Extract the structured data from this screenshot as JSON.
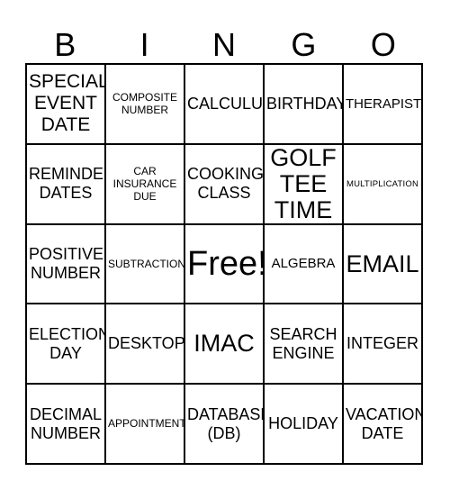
{
  "card": {
    "title": "BINGO",
    "header_letters": [
      "B",
      "I",
      "N",
      "G",
      "O"
    ],
    "grid_size": "5x5",
    "free_space_index": 12,
    "colors": {
      "background": "#ffffff",
      "text": "#000000",
      "border": "#000000"
    },
    "rows": [
      [
        {
          "text": "SPECIAL\nEVENT\nDATE",
          "size": "lg"
        },
        {
          "text": "COMPOSITE\nNUMBER",
          "size": "xs"
        },
        {
          "text": "CALCULUS",
          "size": "md"
        },
        {
          "text": "BIRTHDAY",
          "size": "md"
        },
        {
          "text": "THERAPIST",
          "size": "sm"
        }
      ],
      [
        {
          "text": "REMINDER\nDATES",
          "size": "md"
        },
        {
          "text": "CAR\nINSURANCE\nDUE",
          "size": "xs"
        },
        {
          "text": "COOKING\nCLASS",
          "size": "md"
        },
        {
          "text": "GOLF\nTEE\nTIME",
          "size": "xl"
        },
        {
          "text": "MULTIPLICATION",
          "size": "xxs"
        }
      ],
      [
        {
          "text": "POSITIVE\nNUMBER",
          "size": "md"
        },
        {
          "text": "SUBTRACTION",
          "size": "xs"
        },
        {
          "text": "Free!",
          "size": "xxl"
        },
        {
          "text": "ALGEBRA",
          "size": "sm"
        },
        {
          "text": "EMAIL",
          "size": "xl"
        }
      ],
      [
        {
          "text": "ELECTION\nDAY",
          "size": "md"
        },
        {
          "text": "DESKTOP",
          "size": "md"
        },
        {
          "text": "IMAC",
          "size": "xl"
        },
        {
          "text": "SEARCH\nENGINE",
          "size": "md"
        },
        {
          "text": "INTEGER",
          "size": "md"
        }
      ],
      [
        {
          "text": "DECIMAL\nNUMBER",
          "size": "md"
        },
        {
          "text": "APPOINTMENT",
          "size": "xs"
        },
        {
          "text": "DATABASE\n(DB)",
          "size": "md"
        },
        {
          "text": "HOLIDAY",
          "size": "md"
        },
        {
          "text": "VACATION\nDATE",
          "size": "md"
        }
      ]
    ]
  }
}
